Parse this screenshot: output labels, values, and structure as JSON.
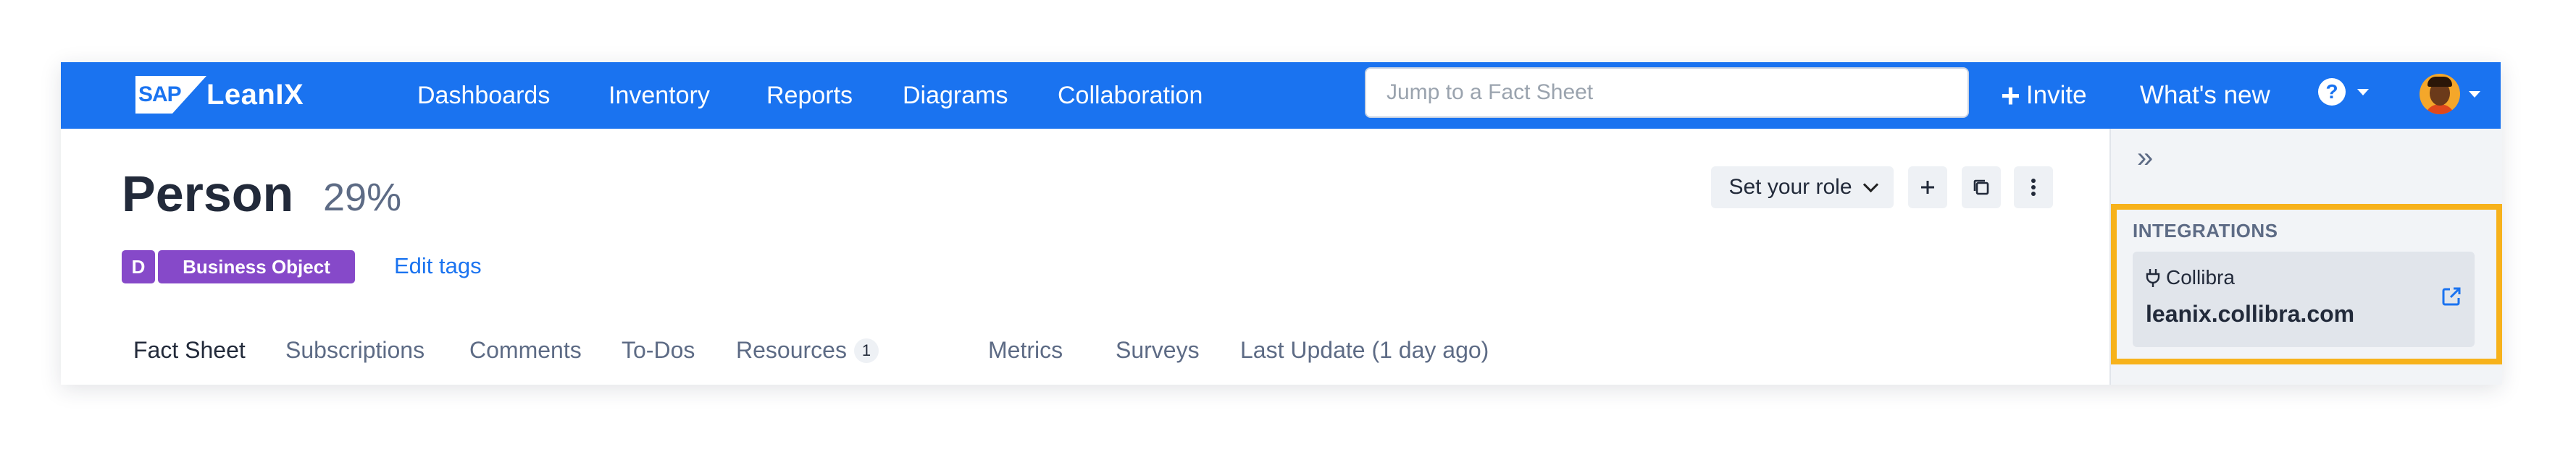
{
  "nav": {
    "logo_mark": "SAP",
    "logo_text": "LeanIX",
    "items": [
      "Dashboards",
      "Inventory",
      "Reports",
      "Diagrams",
      "Collaboration"
    ],
    "search_placeholder": "Jump to a Fact Sheet",
    "invite_label": "Invite",
    "whats_new": "What's new",
    "help_glyph": "?"
  },
  "factsheet": {
    "name": "Person",
    "completion": "29%",
    "type_letter": "D",
    "type_name": "Business Object",
    "edit_tags": "Edit tags",
    "role_button": "Set your role"
  },
  "tabs": [
    {
      "label": "Fact Sheet"
    },
    {
      "label": "Subscriptions"
    },
    {
      "label": "Comments"
    },
    {
      "label": "To-Dos"
    },
    {
      "label": "Resources",
      "count": "1"
    },
    {
      "label": "Metrics"
    },
    {
      "label": "Surveys"
    },
    {
      "label": "Last Update (1 day ago)"
    }
  ],
  "side_panel": {
    "collapse_glyph": "»",
    "section_title": "INTEGRATIONS",
    "integration_name": "Collibra",
    "integration_url": "leanix.collibra.com"
  },
  "colors": {
    "brand_blue": "#1a73f0",
    "type_purple": "#8649c9",
    "highlight_yellow": "#f7b21b"
  }
}
